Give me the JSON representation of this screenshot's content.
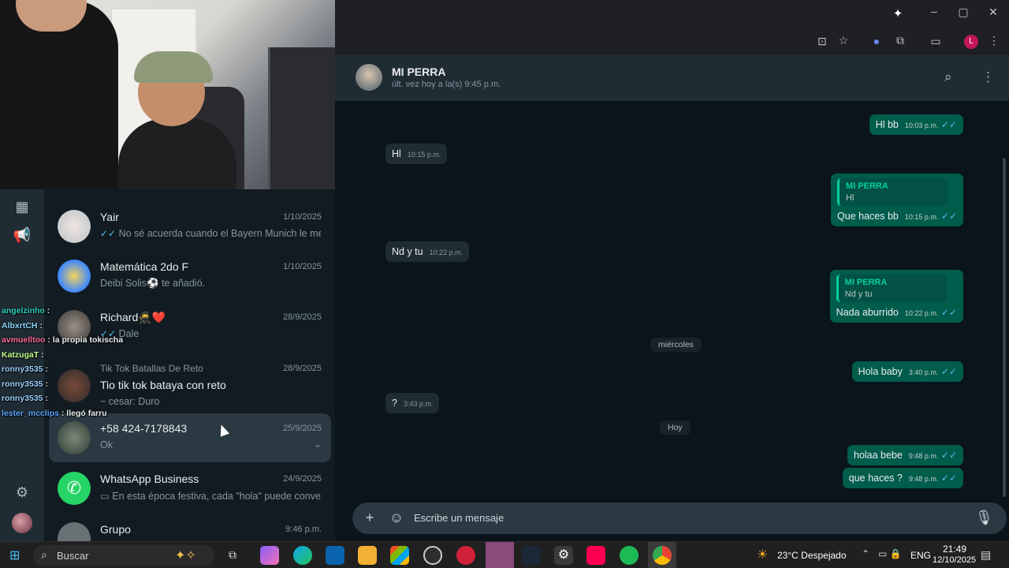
{
  "browser": {
    "ai_icon": "sparkle-icon",
    "profile_initial": "L",
    "window_buttons": [
      "minimize-icon",
      "restore-icon",
      "close-icon"
    ]
  },
  "chat_list": {
    "items": [
      {
        "name": "Yair",
        "date": "1/10/2025",
        "preview": "No sé acuerda cuando el Bayern Munich le meti...",
        "tick": "✓✓"
      },
      {
        "name": "Matemática 2do F",
        "date": "1/10/2025",
        "preview": "Deibi Solis⚽ te añadió."
      },
      {
        "name": "Richard🥷❤️",
        "date": "28/9/2025",
        "preview": "Dale",
        "tick": "✓✓"
      },
      {
        "subtitle": "Tik Tok Batallas De Reto",
        "name": "Tio tik tok bataya con reto",
        "date": "28/9/2025",
        "preview": "~ cesar: Duro"
      },
      {
        "name": "+58 424-7178843",
        "date": "25/9/2025",
        "preview": "Ok"
      },
      {
        "name": "WhatsApp Business",
        "date": "24/9/2025",
        "preview": "En esta época festiva, cada \"hola\" puede conver..."
      },
      {
        "name": "Grupo",
        "date": "9:46 p.m."
      }
    ]
  },
  "stream_chat": [
    {
      "user": "angelzinho",
      "text": ":"
    },
    {
      "user": "AlbxrtCH",
      "text": ":"
    },
    {
      "user": "avmuelltoo",
      "text": ": la propia tokischa"
    },
    {
      "user": "KatzugaT",
      "text": ":"
    },
    {
      "user": "ronny3535",
      "text": ":"
    },
    {
      "user": "ronny3535",
      "text": ":"
    },
    {
      "user": "ronny3535",
      "text": ":"
    },
    {
      "user": "lester_mcclips",
      "text": ": llegó farru"
    }
  ],
  "conversation": {
    "contact": "MI PERRA",
    "status": "últ. vez hoy a la(s) 9:45 p.m.",
    "messages": [
      {
        "dir": "out",
        "text": "Hl bb",
        "time": "10:03 p.m."
      },
      {
        "dir": "in",
        "text": "Hl",
        "time": "10:15 p.m."
      },
      {
        "dir": "out",
        "quote_name": "MI PERRA",
        "quote_text": "Hl",
        "text": "Que haces bb",
        "time": "10:15 p.m."
      },
      {
        "dir": "in",
        "text": "Nd y tu",
        "time": "10:22 p.m."
      },
      {
        "dir": "out",
        "quote_name": "MI PERRA",
        "quote_text": "Nd y tu",
        "text": "Nada aburrido",
        "time": "10:22 p.m."
      },
      {
        "dir": "out",
        "text": "Hola baby",
        "time": "3:40 p.m."
      },
      {
        "dir": "in",
        "text": "?",
        "time": "3:43 p.m."
      },
      {
        "dir": "out",
        "text": "holaa bebe",
        "time": "9:48 p.m."
      },
      {
        "dir": "out",
        "text": "que haces ?",
        "time": "9:48 p.m."
      }
    ],
    "day_labels": [
      "miércoles",
      "Hoy"
    ],
    "composer_placeholder": "Escribe un mensaje"
  },
  "taskbar": {
    "search": "Buscar",
    "weather": "23°C  Despejado",
    "lang": "ENG",
    "time": "21:49",
    "date": "12/10/2025"
  }
}
